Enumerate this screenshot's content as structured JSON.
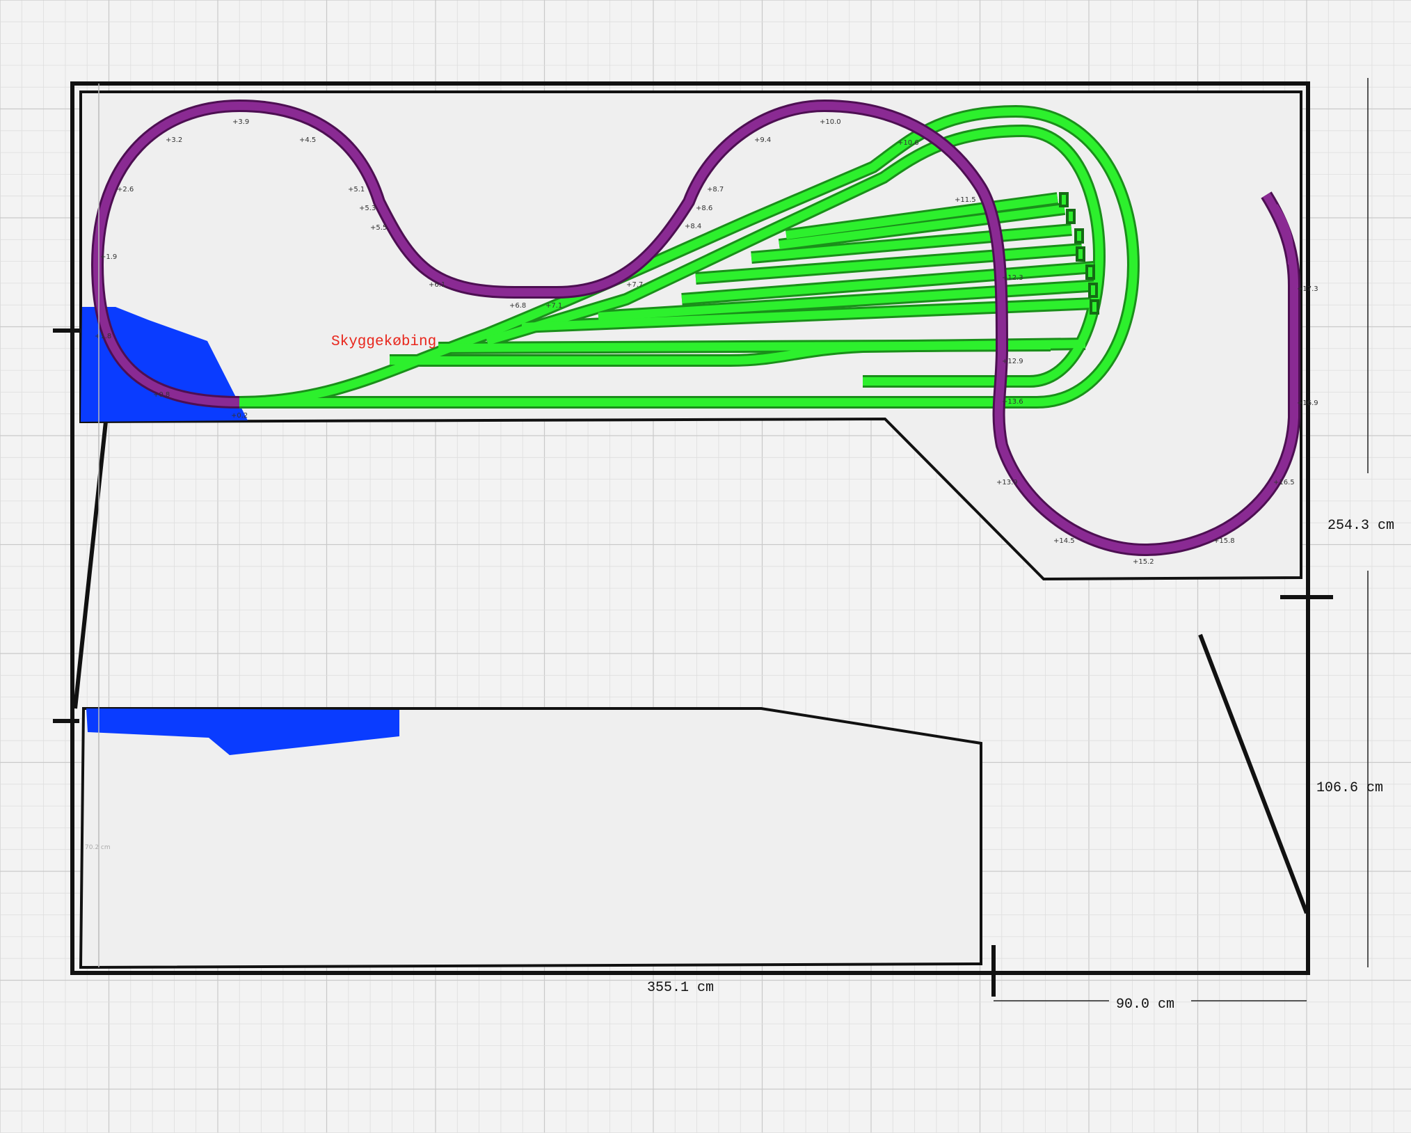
{
  "station_label": "Skyggekøbing",
  "dimensions": {
    "width_main": "355.1 cm",
    "width_right": "90.0 cm",
    "height_total": "254.3 cm",
    "height_lower": "106.6 cm",
    "faint_left": "70.2 cm"
  },
  "elevation_labels": [
    "+3.9",
    "+3.2",
    "+4.5",
    "+2.6",
    "+5.1",
    "+5.3",
    "+5.5",
    "+1.9",
    "+1.8",
    "+0.8",
    "+0.2",
    "+6.1",
    "+6.8",
    "+7.1",
    "+7.7",
    "+8.4",
    "+8.6",
    "+8.7",
    "+9.4",
    "+10.0",
    "+10.6",
    "+11.5",
    "+12.3",
    "+12.9",
    "+13.6",
    "+13.9",
    "+14.5",
    "+15.2",
    "+15.8",
    "+16.5",
    "+16.9",
    "+17.3"
  ],
  "colors": {
    "track_main": "#7e1f86",
    "track_yard": "#1ee61e",
    "scenery": "#0a3cff",
    "label_red": "#e8261c",
    "outline": "#111111"
  }
}
